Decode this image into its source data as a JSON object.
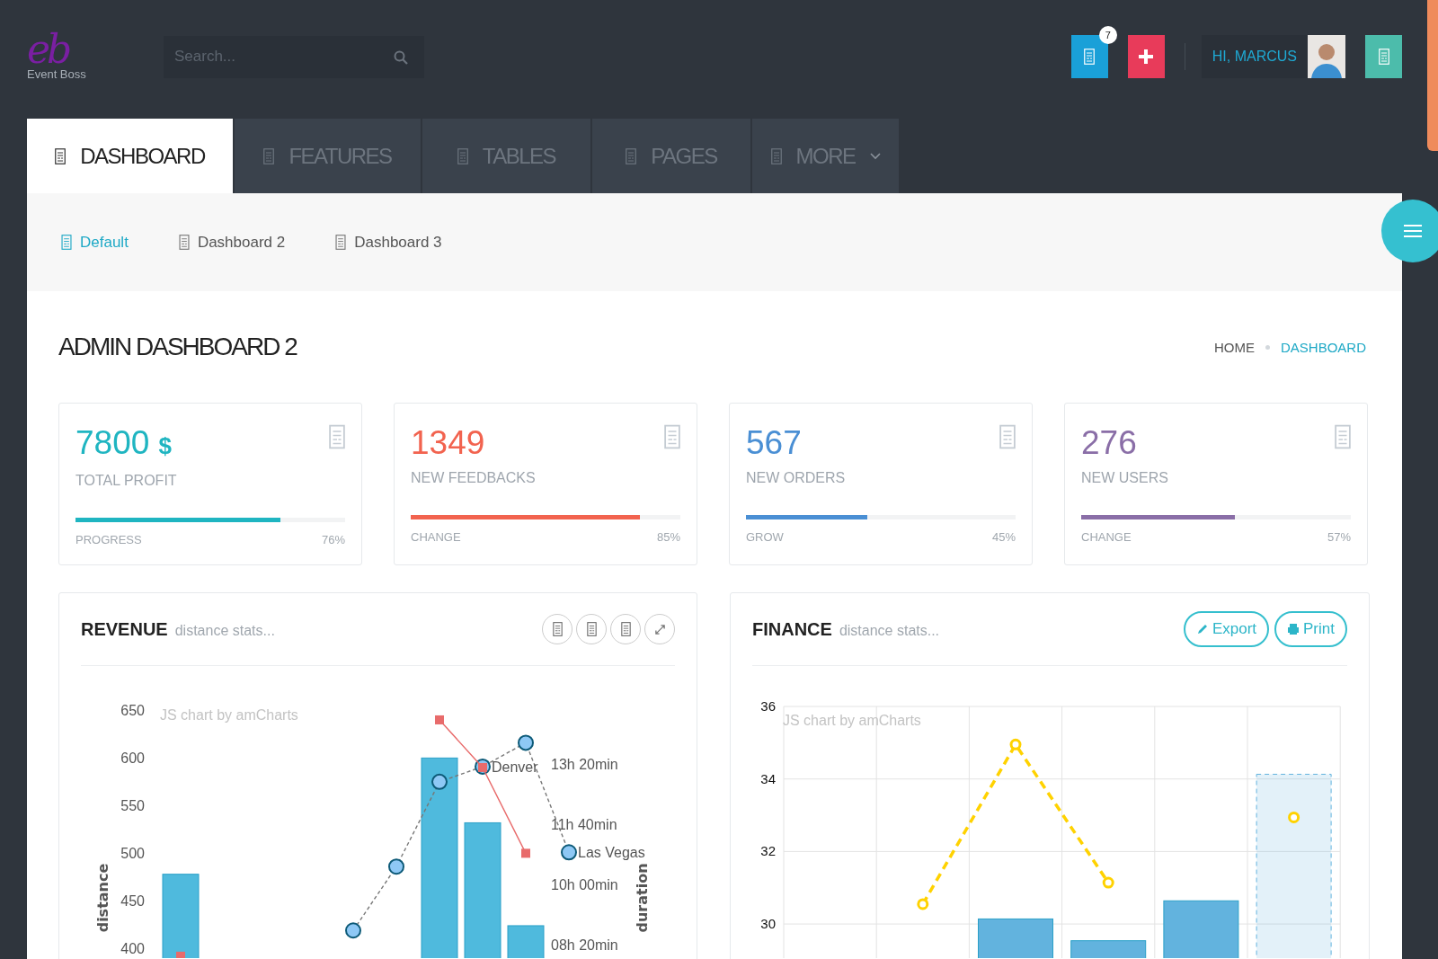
{
  "header": {
    "logo": {
      "mark": "eb",
      "name": "Event Boss"
    },
    "search": {
      "placeholder": "Search..."
    },
    "notification_count": "7",
    "greeting": "HI, MARCUS"
  },
  "tabs": [
    {
      "label": "DASHBOARD",
      "selected": true,
      "dropdown": false
    },
    {
      "label": "FEATURES",
      "selected": false,
      "dropdown": false
    },
    {
      "label": "TABLES",
      "selected": false,
      "dropdown": false
    },
    {
      "label": "PAGES",
      "selected": false,
      "dropdown": false
    },
    {
      "label": "MORE",
      "selected": false,
      "dropdown": true
    }
  ],
  "subnav": [
    {
      "label": "Default",
      "selected": true
    },
    {
      "label": "Dashboard 2",
      "selected": false
    },
    {
      "label": "Dashboard 3",
      "selected": false
    }
  ],
  "page_title": "ADMIN DASHBOARD 2",
  "breadcrumb": [
    {
      "label": "HOME",
      "selected": false
    },
    {
      "label": "DASHBOARD",
      "selected": true
    }
  ],
  "stats": [
    {
      "value": "7800",
      "unit": "$",
      "label": "TOTAL PROFIT",
      "color": "#1fb5c1",
      "level": 0.76,
      "caption": "PROGRESS",
      "percent": "76%"
    },
    {
      "value": "1349",
      "label": "NEW FEEDBACKS",
      "color": "#f2634f",
      "level": 0.85,
      "caption": "CHANGE",
      "percent": "85%"
    },
    {
      "value": "567",
      "label": "NEW ORDERS",
      "color": "#4a8fd4",
      "level": 0.45,
      "caption": "GROW",
      "percent": "45%"
    },
    {
      "value": "276",
      "label": "NEW USERS",
      "color": "#8a6ea7",
      "level": 0.57,
      "caption": "CHANGE",
      "percent": "57%"
    }
  ],
  "panels": [
    {
      "kind": "tools",
      "title": "REVENUE",
      "subtitle": "distance stats...",
      "chart_credit": "JS chart by amCharts",
      "secondary_axis": {
        "title": "duration",
        "ticks": [
          "13h 20min",
          "11h 40min",
          "10h 00min",
          "08h 20min"
        ]
      },
      "point_labels": [
        "Denver",
        "Las Vegas"
      ],
      "primary_axis": {
        "title": "distance",
        "ticks": [
          "650",
          "600",
          "550",
          "500",
          "450",
          "400"
        ]
      }
    },
    {
      "kind": "buttons",
      "title": "FINANCE",
      "subtitle": "distance stats...",
      "chart_credit": "JS chart by amCharts",
      "buttons": [
        "Export",
        "Print"
      ],
      "chart_data": {
        "type": "bar",
        "categories": [
          null,
          null,
          null,
          null,
          null,
          null
        ],
        "ylim": [
          29.06,
          36
        ],
        "yticks": [
          30,
          32,
          34,
          36
        ],
        "grid": true,
        "series": [
          {
            "type": "bar",
            "color": "#62b3de",
            "values": [
              null,
              null,
              30.14,
              29.54,
              30.64,
              34.13
            ]
          },
          {
            "type": "line",
            "color": "#ffd200",
            "line_style": "dashed",
            "marker": "circle",
            "values": [
              null,
              30.55,
              34.95,
              31.14,
              null,
              32.94
            ]
          }
        ]
      }
    }
  ]
}
